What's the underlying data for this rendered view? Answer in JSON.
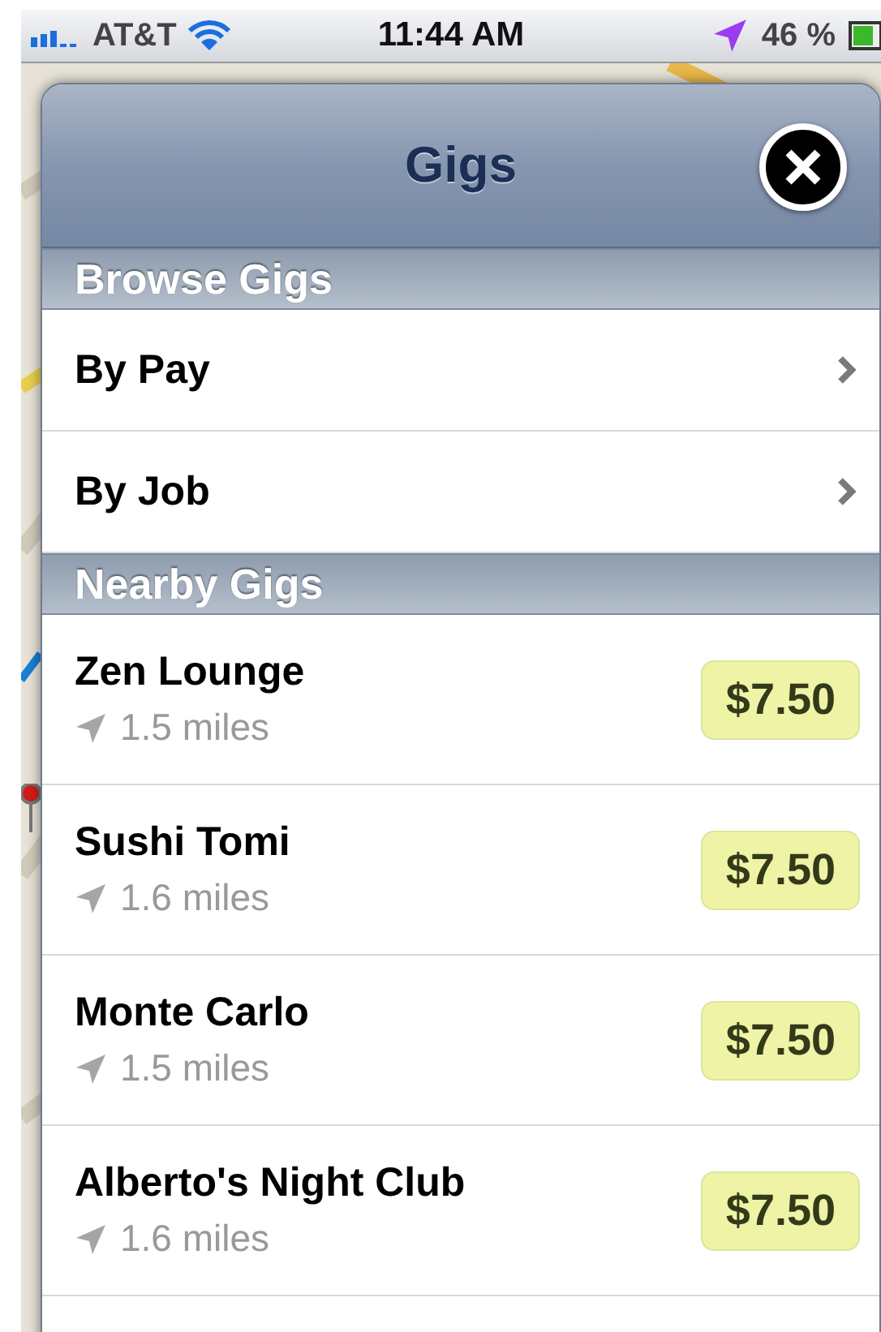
{
  "status_bar": {
    "carrier": "AT&T",
    "time": "11:44 AM",
    "battery": "46 %"
  },
  "header": {
    "title": "Gigs"
  },
  "sections": [
    {
      "title": "Browse Gigs",
      "items": [
        {
          "kind": "link",
          "label": "By Pay"
        },
        {
          "kind": "link",
          "label": "By Job"
        }
      ]
    },
    {
      "title": "Nearby Gigs",
      "items": [
        {
          "kind": "gig",
          "name": "Zen Lounge",
          "distance": "1.5 miles",
          "pay": "$7.50"
        },
        {
          "kind": "gig",
          "name": "Sushi Tomi",
          "distance": "1.6 miles",
          "pay": "$7.50"
        },
        {
          "kind": "gig",
          "name": "Monte Carlo",
          "distance": "1.5 miles",
          "pay": "$7.50"
        },
        {
          "kind": "gig",
          "name": "Alberto's Night Club",
          "distance": "1.6 miles",
          "pay": "$7.50"
        }
      ]
    }
  ]
}
